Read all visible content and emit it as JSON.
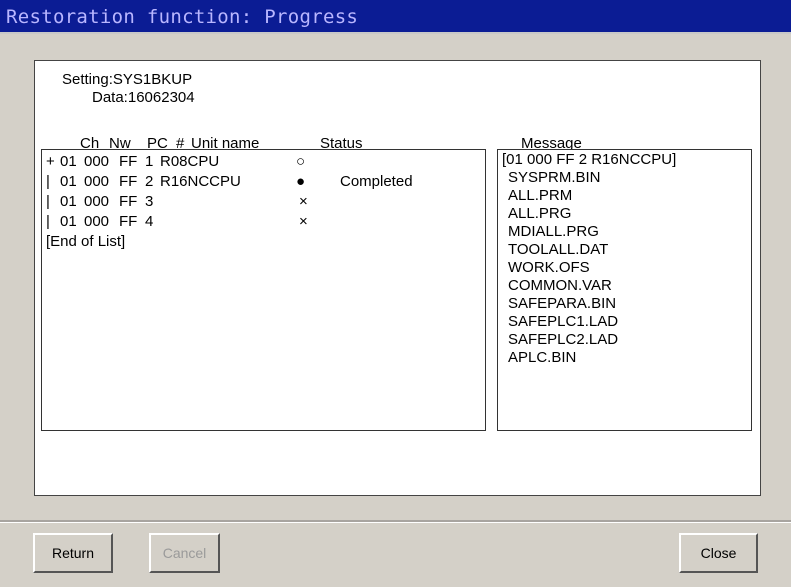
{
  "window": {
    "title": "Restoration function: Progress"
  },
  "info": {
    "setting_label": "Setting:SYS1BKUP",
    "data_label": "Data:16062304"
  },
  "list": {
    "headers": {
      "ch": "Ch",
      "nw": "Nw",
      "pc": "PC",
      "num": "#",
      "unit": "Unit name",
      "status": "Status"
    },
    "rows": [
      {
        "prefix": "+",
        "ch": "01",
        "nw": "000",
        "pc": "FF",
        "num": "1",
        "unit": "R08CPU",
        "mark": "○",
        "status": ""
      },
      {
        "prefix": "|",
        "ch": "01",
        "nw": "000",
        "pc": "FF",
        "num": "2",
        "unit": "R16NCCPU",
        "mark": "●",
        "status": "Completed"
      },
      {
        "prefix": "|",
        "ch": "01",
        "nw": "000",
        "pc": "FF",
        "num": "3",
        "unit": "",
        "mark": "×",
        "status": ""
      },
      {
        "prefix": "|",
        "ch": "01",
        "nw": "000",
        "pc": "FF",
        "num": "4",
        "unit": "",
        "mark": "×",
        "status": ""
      }
    ],
    "end_text": "[End of List]"
  },
  "messages": {
    "header": "Message",
    "items": [
      "[01 000 FF 2 R16NCCPU]",
      "SYSPRM.BIN",
      "ALL.PRM",
      "ALL.PRG",
      "MDIALL.PRG",
      "TOOLALL.DAT",
      "WORK.OFS",
      "COMMON.VAR",
      "SAFEPARA.BIN",
      "SAFEPLC1.LAD",
      "SAFEPLC2.LAD",
      "APLC.BIN"
    ]
  },
  "buttons": {
    "return": "Return",
    "cancel": "Cancel",
    "close": "Close"
  }
}
